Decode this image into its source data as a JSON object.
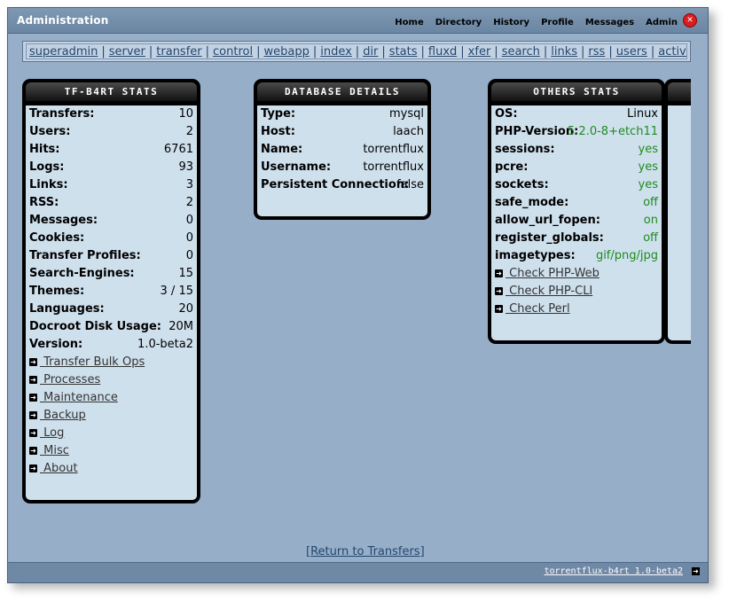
{
  "app_title": "Administration",
  "top_nav": [
    "Home",
    "Directory",
    "History",
    "Profile",
    "Messages",
    "Admin"
  ],
  "close_symbol": "✕",
  "admin_links": [
    "superadmin",
    "server",
    "transfer",
    "control",
    "webapp",
    "index",
    "dir",
    "stats",
    "fluxd",
    "xfer",
    "search",
    "links",
    "rss",
    "users",
    "activity"
  ],
  "link_separator": "|",
  "tf_stats": {
    "title": "TF-B4RT STATS",
    "rows": [
      {
        "label": "Transfers:",
        "value": "10"
      },
      {
        "label": "Users:",
        "value": "2"
      },
      {
        "label": "Hits:",
        "value": "6761"
      },
      {
        "label": "Logs:",
        "value": "93"
      },
      {
        "label": "Links:",
        "value": "3"
      },
      {
        "label": "RSS:",
        "value": "2"
      },
      {
        "label": "Messages:",
        "value": "0"
      },
      {
        "label": "Cookies:",
        "value": "0"
      },
      {
        "label": "Transfer Profiles:",
        "value": "0"
      },
      {
        "label": "Search-Engines:",
        "value": "15"
      },
      {
        "label": "Themes:",
        "value": "3 / 15"
      },
      {
        "label": "Languages:",
        "value": "20"
      },
      {
        "label": "Docroot Disk Usage:",
        "value": "20M"
      },
      {
        "label": "Version:",
        "value": "1.0-beta2"
      }
    ],
    "links": [
      " Transfer Bulk Ops",
      " Processes",
      " Maintenance",
      " Backup",
      " Log",
      " Misc",
      " About"
    ]
  },
  "db_details": {
    "title": "DATABASE DETAILS",
    "rows": [
      {
        "label": "Type:",
        "value": "mysql"
      },
      {
        "label": "Host:",
        "value": "laach"
      },
      {
        "label": "Name:",
        "value": "torrentflux"
      },
      {
        "label": "Username:",
        "value": "torrentflux"
      },
      {
        "label": "Persistent Connection:",
        "value": "false"
      }
    ]
  },
  "others_stats": {
    "title": "OTHERS STATS",
    "rows": [
      {
        "label": "OS:",
        "value": "Linux",
        "status": "plain"
      },
      {
        "label": "PHP-Version:",
        "value": "5.2.0-8+etch11",
        "status": "ok"
      },
      {
        "label": "sessions:",
        "value": "yes",
        "status": "ok"
      },
      {
        "label": "pcre:",
        "value": "yes",
        "status": "ok"
      },
      {
        "label": "sockets:",
        "value": "yes",
        "status": "ok"
      },
      {
        "label": "safe_mode:",
        "value": "off",
        "status": "ok"
      },
      {
        "label": "allow_url_fopen:",
        "value": "on",
        "status": "ok"
      },
      {
        "label": "register_globals:",
        "value": "off",
        "status": "ok"
      },
      {
        "label": "imagetypes:",
        "value": "gif/png/jpg",
        "status": "ok"
      }
    ],
    "links": [
      " Check PHP-Web",
      " Check PHP-CLI",
      " Check Perl"
    ]
  },
  "return_link": {
    "open": "[",
    "label": "Return to Transfers",
    "close": "]"
  },
  "footer_text": "torrentflux-b4rt 1.0-beta2",
  "arrow_symbol": "➜",
  "colors": {
    "ok": "#1e8b1e",
    "background": "#96aec8",
    "panel": "#cfe0ed"
  }
}
